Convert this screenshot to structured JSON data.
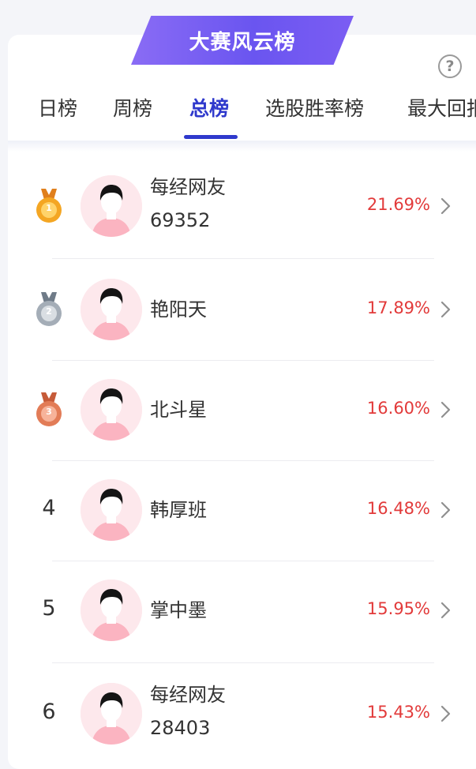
{
  "header": {
    "title": "大赛风云榜",
    "help_icon": "question-circle-icon"
  },
  "tabs": [
    {
      "label": "日榜",
      "active": false
    },
    {
      "label": "周榜",
      "active": false
    },
    {
      "label": "总榜",
      "active": true
    },
    {
      "label": "选股胜率榜",
      "active": false
    },
    {
      "label": "最大回报榜",
      "active": false
    }
  ],
  "colors": {
    "accent": "#2f39cc",
    "rate": "#e23a3a",
    "banner": "#7b5df3",
    "gold": "#f2a21c",
    "silver": "#9aa3ad",
    "bronze": "#df7a54"
  },
  "rankings": [
    {
      "rank": "1",
      "medal": "gold-medal-icon",
      "name_line1": "每经网友",
      "name_line2": "69352",
      "rate": "21.69%"
    },
    {
      "rank": "2",
      "medal": "silver-medal-icon",
      "name_line1": "艳阳天",
      "name_line2": "",
      "rate": "17.89%"
    },
    {
      "rank": "3",
      "medal": "bronze-medal-icon",
      "name_line1": "北斗星",
      "name_line2": "",
      "rate": "16.60%"
    },
    {
      "rank": "4",
      "medal": "",
      "name_line1": "韩厚班",
      "name_line2": "",
      "rate": "16.48%"
    },
    {
      "rank": "5",
      "medal": "",
      "name_line1": "掌中墨",
      "name_line2": "",
      "rate": "15.95%"
    },
    {
      "rank": "6",
      "medal": "",
      "name_line1": "每经网友",
      "name_line2": "28403",
      "rate": "15.43%"
    }
  ]
}
